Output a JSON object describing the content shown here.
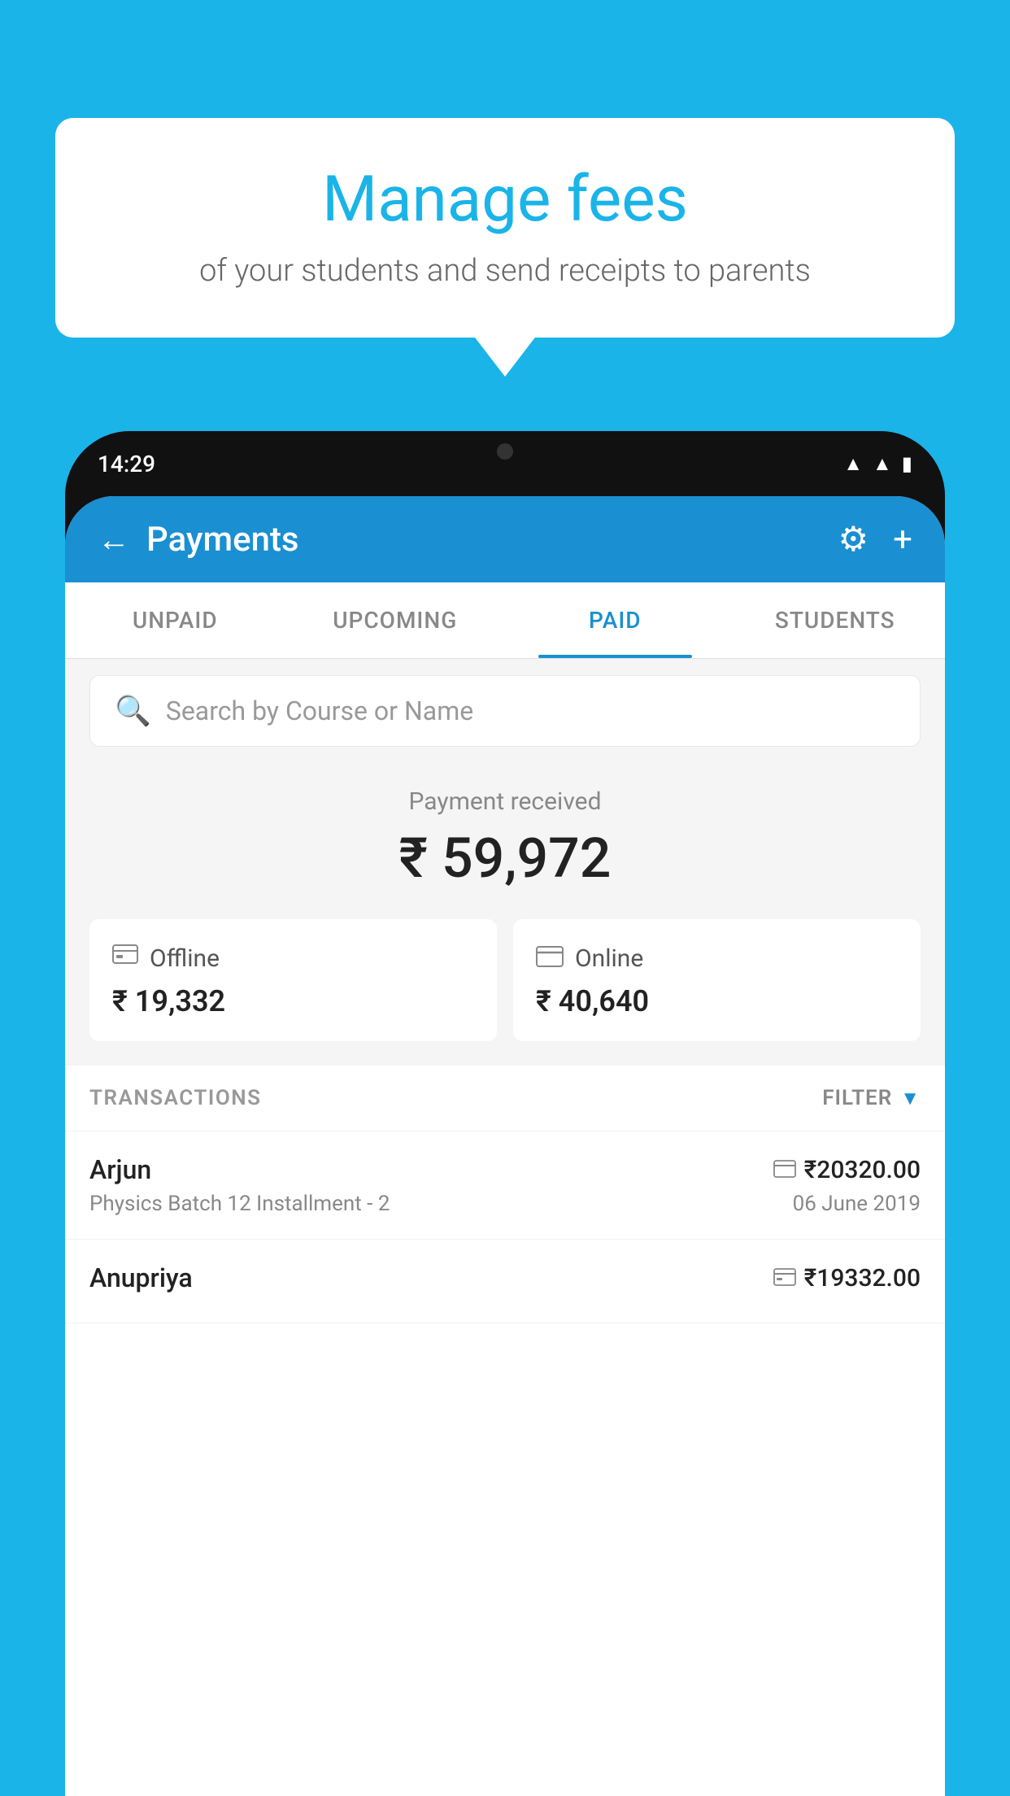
{
  "background_color": "#1ab4e8",
  "speech_bubble": {
    "heading": "Manage fees",
    "subtext": "of your students and send receipts to parents"
  },
  "status_bar": {
    "time": "14:29",
    "wifi_icon": "▲",
    "signal_icon": "▲",
    "battery_icon": "▮"
  },
  "header": {
    "title": "Payments",
    "back_label": "←",
    "settings_label": "⚙",
    "add_label": "+"
  },
  "tabs": [
    {
      "label": "UNPAID",
      "active": false
    },
    {
      "label": "UPCOMING",
      "active": false
    },
    {
      "label": "PAID",
      "active": true
    },
    {
      "label": "STUDENTS",
      "active": false
    }
  ],
  "search": {
    "placeholder": "Search by Course or Name"
  },
  "payment_summary": {
    "label": "Payment received",
    "amount": "₹ 59,972"
  },
  "payment_cards": [
    {
      "icon": "offline",
      "label": "Offline",
      "amount": "₹ 19,332"
    },
    {
      "icon": "online",
      "label": "Online",
      "amount": "₹ 40,640"
    }
  ],
  "transactions_label": "TRANSACTIONS",
  "filter_label": "FILTER",
  "transactions": [
    {
      "name": "Arjun",
      "detail": "Physics Batch 12 Installment - 2",
      "date": "06 June 2019",
      "amount": "₹20320.00",
      "type": "online"
    },
    {
      "name": "Anupriya",
      "detail": "",
      "date": "",
      "amount": "₹19332.00",
      "type": "offline"
    }
  ]
}
